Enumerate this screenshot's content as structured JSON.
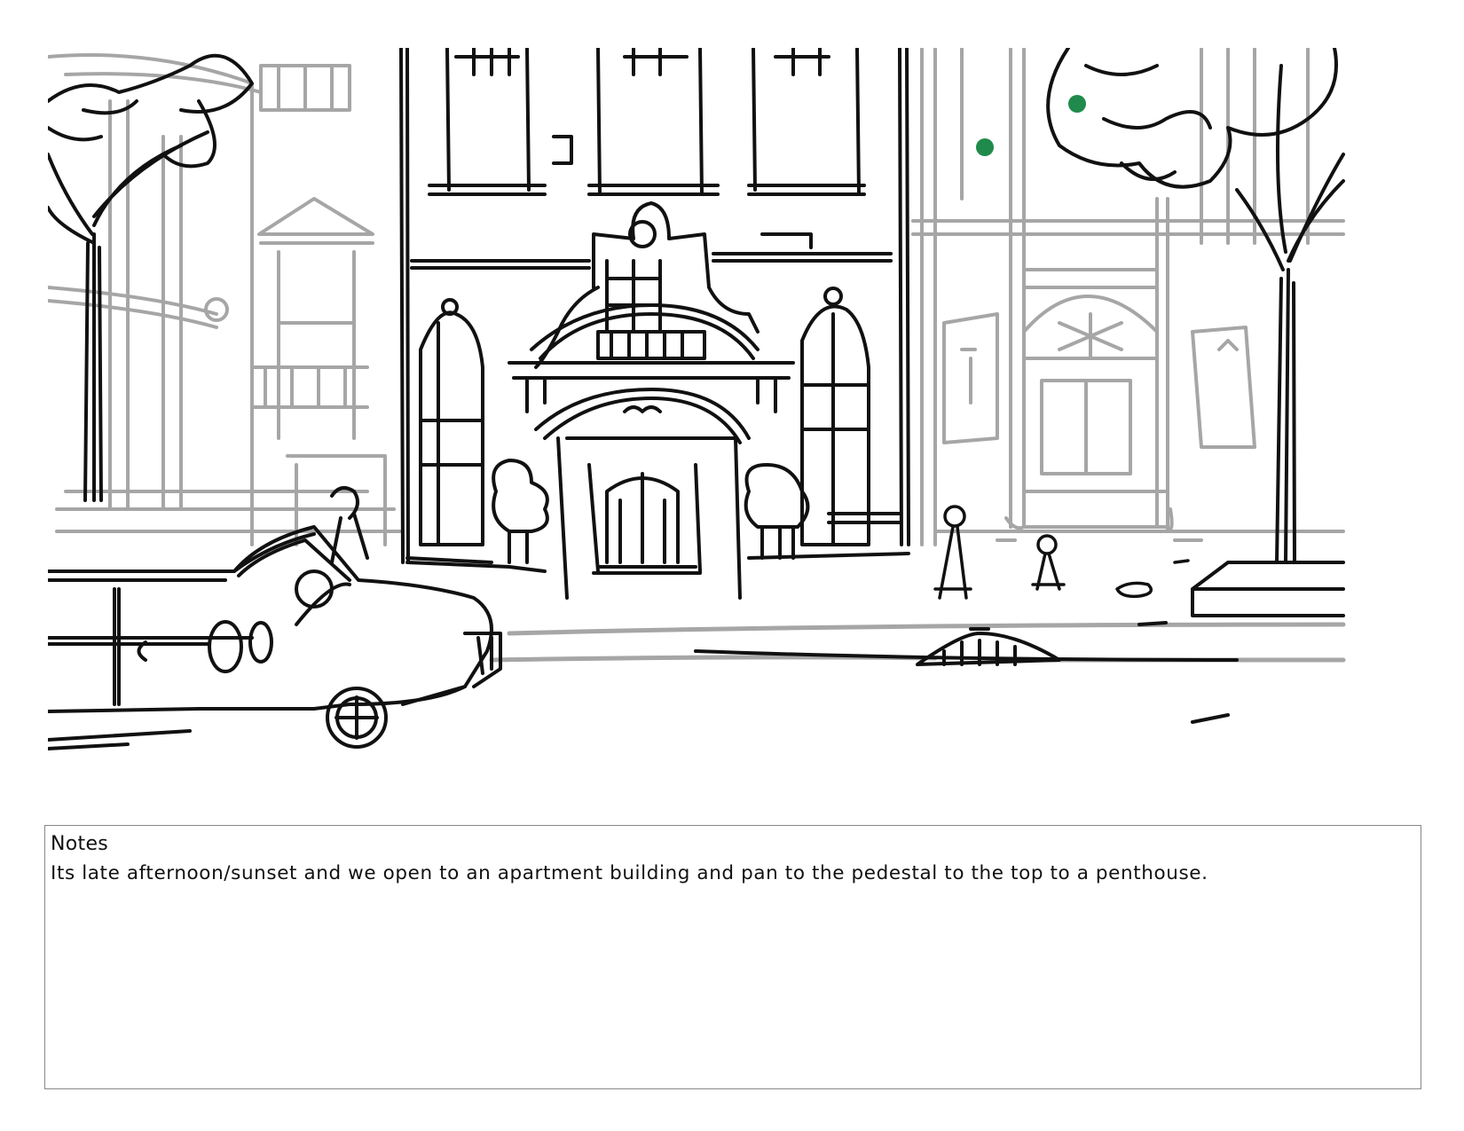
{
  "notes": {
    "title": "Notes",
    "body": "Its late afternoon/sunset and we open to an apartment building and pan to the pedestal to the top to a penthouse."
  },
  "colors": {
    "ink": "#111111",
    "pencil": "#9a9a9a",
    "marker": "#1f8a4c"
  }
}
